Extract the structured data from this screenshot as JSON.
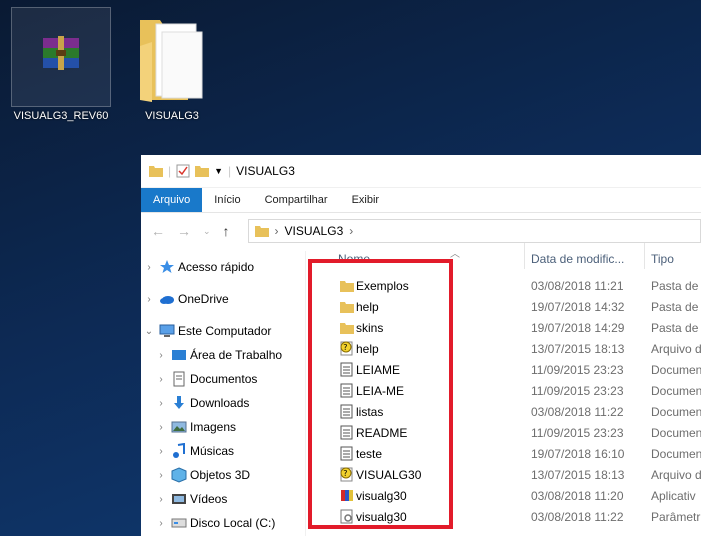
{
  "desktop": {
    "icons": [
      {
        "label": "VISUALG3_REV60",
        "icon": "winrar-archive-icon"
      },
      {
        "label": "VISUALG3",
        "icon": "folder-icon"
      }
    ]
  },
  "window": {
    "title": "VISUALG3",
    "ribbon_tabs": [
      "Arquivo",
      "Início",
      "Compartilhar",
      "Exibir"
    ],
    "address": {
      "path": [
        "VISUALG3"
      ]
    },
    "nav_pane": [
      {
        "label": "Acesso rápido",
        "icon": "star-icon",
        "level": 0
      },
      {
        "label": "OneDrive",
        "icon": "cloud-icon",
        "level": 0
      },
      {
        "label": "Este Computador",
        "icon": "computer-icon",
        "level": 0
      },
      {
        "label": "Área de Trabalho",
        "icon": "desktop-icon",
        "level": 1
      },
      {
        "label": "Documentos",
        "icon": "documents-icon",
        "level": 1
      },
      {
        "label": "Downloads",
        "icon": "download-icon",
        "level": 1
      },
      {
        "label": "Imagens",
        "icon": "pictures-icon",
        "level": 1
      },
      {
        "label": "Músicas",
        "icon": "music-icon",
        "level": 1
      },
      {
        "label": "Objetos 3D",
        "icon": "cube-icon",
        "level": 1
      },
      {
        "label": "Vídeos",
        "icon": "video-icon",
        "level": 1
      },
      {
        "label": "Disco Local (C:)",
        "icon": "drive-icon",
        "level": 1
      }
    ],
    "columns": {
      "name": "Nome",
      "date": "Data de modific...",
      "type": "Tipo"
    },
    "files": [
      {
        "name": "Exemplos",
        "date": "03/08/2018 11:21",
        "type": "Pasta de a",
        "icon": "folder-icon"
      },
      {
        "name": "help",
        "date": "19/07/2018 14:32",
        "type": "Pasta de a",
        "icon": "folder-icon"
      },
      {
        "name": "skins",
        "date": "19/07/2018 14:29",
        "type": "Pasta de a",
        "icon": "folder-icon"
      },
      {
        "name": "help",
        "date": "13/07/2015 18:13",
        "type": "Arquivo d",
        "icon": "help-file-icon"
      },
      {
        "name": "LEIAME",
        "date": "11/09/2015 23:23",
        "type": "Documen",
        "icon": "text-file-icon"
      },
      {
        "name": "LEIA-ME",
        "date": "11/09/2015 23:23",
        "type": "Documen",
        "icon": "text-file-icon"
      },
      {
        "name": "listas",
        "date": "03/08/2018 11:22",
        "type": "Documen",
        "icon": "text-file-icon"
      },
      {
        "name": "README",
        "date": "11/09/2015 23:23",
        "type": "Documen",
        "icon": "text-file-icon"
      },
      {
        "name": "teste",
        "date": "19/07/2018 16:10",
        "type": "Documen",
        "icon": "text-file-icon"
      },
      {
        "name": "VISUALG30",
        "date": "13/07/2015 18:13",
        "type": "Arquivo d",
        "icon": "help-file-icon"
      },
      {
        "name": "visualg30",
        "date": "03/08/2018 11:20",
        "type": "Aplicativ",
        "icon": "application-icon"
      },
      {
        "name": "visualg30",
        "date": "03/08/2018 11:22",
        "type": "Parâmetr",
        "icon": "settings-file-icon"
      }
    ]
  },
  "colors": {
    "highlight": "#e21b2a",
    "file_tab": "#1979ca"
  }
}
